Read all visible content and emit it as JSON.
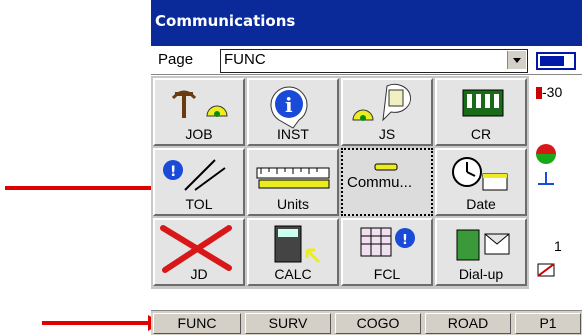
{
  "window": {
    "title": "Communications"
  },
  "page": {
    "label": "Page",
    "selected": "FUNC"
  },
  "tiles": [
    {
      "label": "JOB",
      "icon": "job-icon"
    },
    {
      "label": "INST",
      "icon": "info-icon"
    },
    {
      "label": "JS",
      "icon": "job-settings-icon"
    },
    {
      "label": "CR",
      "icon": "control-record-icon"
    },
    {
      "label": "TOL",
      "icon": "tolerance-icon"
    },
    {
      "label": "Units",
      "icon": "units-ruler-icon"
    },
    {
      "label": "Commu...",
      "icon": "communications-icon"
    },
    {
      "label": "Date",
      "icon": "clock-calendar-icon"
    },
    {
      "label": "JD",
      "icon": "delete-job-icon"
    },
    {
      "label": "CALC",
      "icon": "calculator-icon"
    },
    {
      "label": "FCL",
      "icon": "feature-code-list-icon"
    },
    {
      "label": "Dial-up",
      "icon": "dial-up-icon"
    }
  ],
  "side": {
    "value": "-30",
    "label2": "1"
  },
  "tabs": [
    "FUNC",
    "SURV",
    "COGO",
    "ROAD",
    "P1"
  ],
  "colors": {
    "titlebar": "#0a2a9a",
    "arrow": "#e00000",
    "tile": "#e4e4e4"
  }
}
